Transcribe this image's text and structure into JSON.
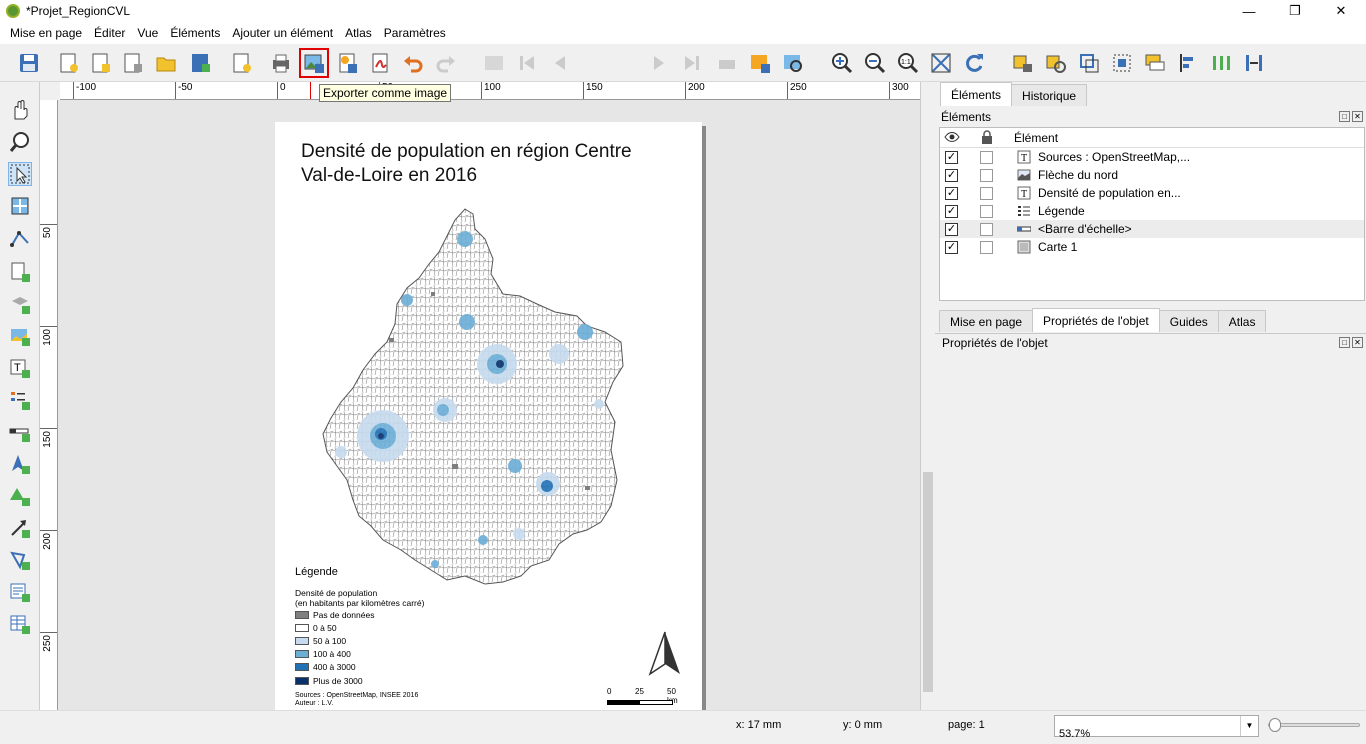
{
  "window": {
    "title": "*Projet_RegionCVL"
  },
  "menu": [
    "Mise en page",
    "Éditer",
    "Vue",
    "Éléments",
    "Ajouter un élément",
    "Atlas",
    "Paramètres"
  ],
  "toolbar": {
    "page_number": "1",
    "tooltip": "Exporter comme image"
  },
  "rulers": {
    "top": [
      "-100",
      "-50",
      "0",
      "50",
      "100",
      "150",
      "200",
      "250",
      "300"
    ],
    "left": [
      "50",
      "100",
      "150",
      "200",
      "250"
    ]
  },
  "layout_page": {
    "title": "Densité de population en région Centre Val-de-Loire en 2016",
    "legend": {
      "heading": "Légende",
      "subtitle_1": "Densité de population",
      "subtitle_2": "(en habitants par kilomètres carré)",
      "classes": [
        {
          "label": "Pas de données",
          "color": "#7f7f7f"
        },
        {
          "label": "0 à 50",
          "color": "#ffffff"
        },
        {
          "label": "50 à 100",
          "color": "#c6dbef"
        },
        {
          "label": "100 à 400",
          "color": "#6baed6"
        },
        {
          "label": "400 à 3000",
          "color": "#2171b5"
        },
        {
          "label": "Plus de 3000",
          "color": "#08306b"
        }
      ]
    },
    "sources_line_1": "Sources : OpenStreetMap, INSEE 2016",
    "sources_line_2": "Auteur : L.V.",
    "scale": {
      "labels": [
        "0",
        "25",
        "50 km"
      ]
    }
  },
  "right_panel": {
    "top_tabs": [
      "Éléments",
      "Historique"
    ],
    "items_header": "Éléments",
    "column_element": "Élément",
    "items": [
      {
        "label": "Sources : OpenStreetMap,...",
        "visible": true,
        "locked": false,
        "icon": "text-icon",
        "selected": false
      },
      {
        "label": "Flèche du nord",
        "visible": true,
        "locked": false,
        "icon": "picture-icon",
        "selected": false
      },
      {
        "label": "Densité de population en...",
        "visible": true,
        "locked": false,
        "icon": "text-icon",
        "selected": false
      },
      {
        "label": "Légende",
        "visible": true,
        "locked": false,
        "icon": "legend-icon",
        "selected": false
      },
      {
        "label": "<Barre d'échelle>",
        "visible": true,
        "locked": false,
        "icon": "scalebar-icon",
        "selected": true
      },
      {
        "label": "Carte 1",
        "visible": true,
        "locked": false,
        "icon": "map-icon",
        "selected": false
      }
    ],
    "bottom_tabs": [
      "Mise en page",
      "Propriétés de l'objet",
      "Guides",
      "Atlas"
    ],
    "properties_header": "Propriétés de l'objet"
  },
  "status": {
    "x": "x: 17 mm",
    "y": "y: 0 mm",
    "page": "page: 1",
    "zoom": "53.7%"
  },
  "colors": {
    "accent": "#e00000",
    "selection": "#cde3f7"
  }
}
